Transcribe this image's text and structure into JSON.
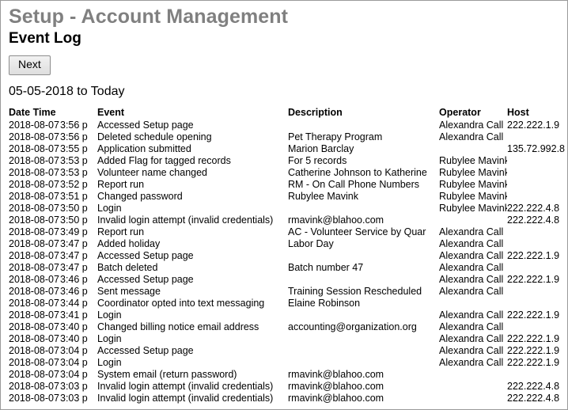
{
  "page": {
    "title": "Setup - Account Management",
    "section_title": "Event Log",
    "date_range": "05-05-2018 to Today"
  },
  "toolbar": {
    "next_label": "Next"
  },
  "table": {
    "headers": {
      "date_time": "Date Time",
      "event": "Event",
      "description": "Description",
      "operator": "Operator",
      "host": "Host"
    },
    "rows": [
      {
        "date": "2018-08-07",
        "time": "3:56 p",
        "event": "Accessed Setup page",
        "description": "",
        "operator": "Alexandra Call",
        "host": "222.222.1.9"
      },
      {
        "date": "2018-08-07",
        "time": "3:56 p",
        "event": "Deleted schedule opening",
        "description": "Pet Therapy Program",
        "operator": "Alexandra Call",
        "host": ""
      },
      {
        "date": "2018-08-07",
        "time": "3:55 p",
        "event": "Application submitted",
        "description": "Marion Barclay",
        "operator": "",
        "host": "135.72.992.8"
      },
      {
        "date": "2018-08-07",
        "time": "3:53 p",
        "event": "Added Flag for tagged records",
        "description": "For 5 records",
        "operator": "Rubylee Mavink",
        "host": ""
      },
      {
        "date": "2018-08-07",
        "time": "3:53 p",
        "event": "Volunteer name changed",
        "description": "Catherine Johnson to Katherine",
        "operator": "Rubylee Mavink",
        "host": ""
      },
      {
        "date": "2018-08-07",
        "time": "3:52 p",
        "event": "Report run",
        "description": "RM - On Call Phone Numbers",
        "operator": "Rubylee Mavink",
        "host": ""
      },
      {
        "date": "2018-08-07",
        "time": "3:51 p",
        "event": "Changed password",
        "description": "Rubylee Mavink",
        "operator": "Rubylee Mavink",
        "host": ""
      },
      {
        "date": "2018-08-07",
        "time": "3:50 p",
        "event": "Login",
        "description": "",
        "operator": "Rubylee Mavink",
        "host": "222.222.4.8"
      },
      {
        "date": "2018-08-07",
        "time": "3:50 p",
        "event": "Invalid login attempt (invalid credentials)",
        "description": "rmavink@blahoo.com",
        "operator": "",
        "host": "222.222.4.8"
      },
      {
        "date": "2018-08-07",
        "time": "3:49 p",
        "event": "Report run",
        "description": "AC - Volunteer Service by Quar",
        "operator": "Alexandra Call",
        "host": ""
      },
      {
        "date": "2018-08-07",
        "time": "3:47 p",
        "event": "Added holiday",
        "description": "Labor Day",
        "operator": "Alexandra Call",
        "host": ""
      },
      {
        "date": "2018-08-07",
        "time": "3:47 p",
        "event": "Accessed Setup page",
        "description": "",
        "operator": "Alexandra Call",
        "host": "222.222.1.9"
      },
      {
        "date": "2018-08-07",
        "time": "3:47 p",
        "event": "Batch deleted",
        "description": "Batch number 47",
        "operator": "Alexandra Call",
        "host": ""
      },
      {
        "date": "2018-08-07",
        "time": "3:46 p",
        "event": "Accessed Setup page",
        "description": "",
        "operator": "Alexandra Call",
        "host": "222.222.1.9"
      },
      {
        "date": "2018-08-07",
        "time": "3:46 p",
        "event": "Sent message",
        "description": "Training Session Rescheduled",
        "operator": "Alexandra Call",
        "host": ""
      },
      {
        "date": "2018-08-07",
        "time": "3:44 p",
        "event": "Coordinator opted into text messaging",
        "description": "Elaine Robinson",
        "operator": "",
        "host": ""
      },
      {
        "date": "2018-08-07",
        "time": "3:41 p",
        "event": "Login",
        "description": "",
        "operator": "Alexandra Call",
        "host": "222.222.1.9"
      },
      {
        "date": "2018-08-07",
        "time": "3:40 p",
        "event": "Changed billing notice email address",
        "description": "accounting@organization.org",
        "operator": "Alexandra Call",
        "host": ""
      },
      {
        "date": "2018-08-07",
        "time": "3:40 p",
        "event": "Login",
        "description": "",
        "operator": "Alexandra Call",
        "host": "222.222.1.9"
      },
      {
        "date": "2018-08-07",
        "time": "3:04 p",
        "event": "Accessed Setup page",
        "description": "",
        "operator": "Alexandra Call",
        "host": "222.222.1.9"
      },
      {
        "date": "2018-08-07",
        "time": "3:04 p",
        "event": "Login",
        "description": "",
        "operator": "Alexandra Call",
        "host": "222.222.1.9"
      },
      {
        "date": "2018-08-07",
        "time": "3:04 p",
        "event": "System email (return password)",
        "description": "rmavink@blahoo.com",
        "operator": "",
        "host": ""
      },
      {
        "date": "2018-08-07",
        "time": "3:03 p",
        "event": "Invalid login attempt (invalid credentials)",
        "description": "rmavink@blahoo.com",
        "operator": "",
        "host": "222.222.4.8"
      },
      {
        "date": "2018-08-07",
        "time": "3:03 p",
        "event": "Invalid login attempt (invalid credentials)",
        "description": "rmavink@blahoo.com",
        "operator": "",
        "host": "222.222.4.8"
      }
    ]
  }
}
